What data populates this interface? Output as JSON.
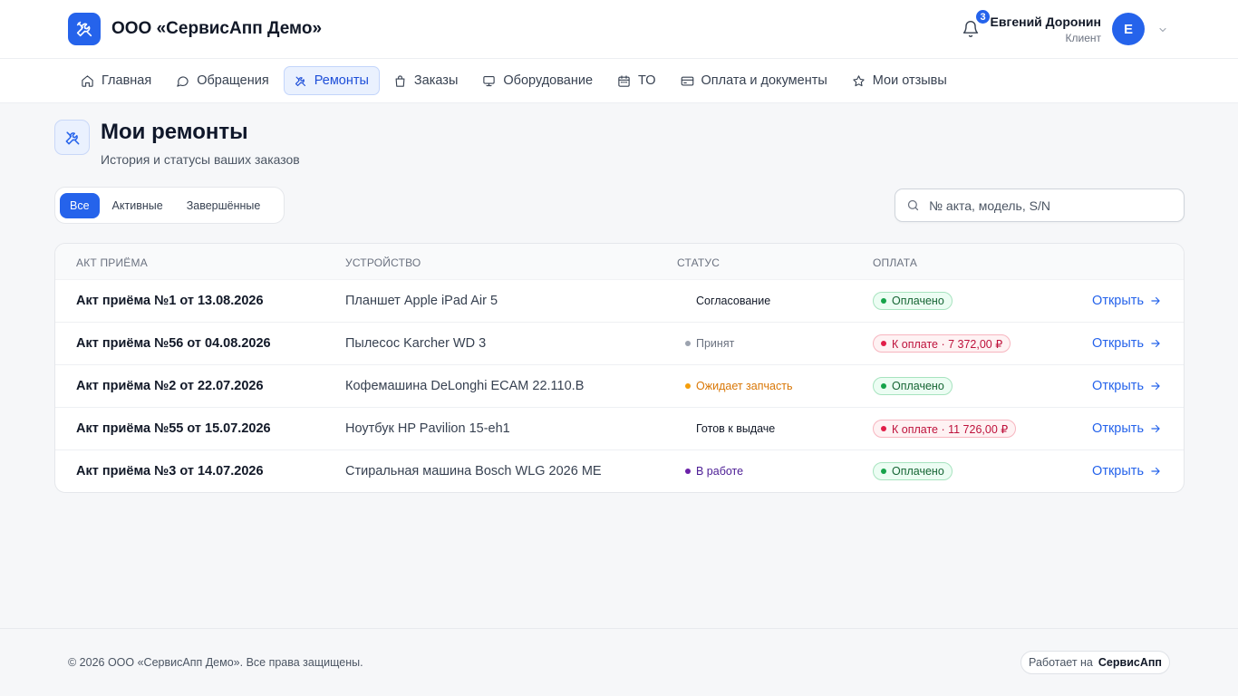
{
  "header": {
    "brand_name": "ООО «СервисАпп Демо»",
    "notifications_count": "3",
    "user_name": "Евгений Доронин",
    "user_role": "Клиент",
    "avatar_letter": "Е"
  },
  "nav": {
    "items": [
      {
        "label": "Главная",
        "icon": "home-icon"
      },
      {
        "label": "Обращения",
        "icon": "chat-icon"
      },
      {
        "label": "Ремонты",
        "icon": "tools-icon",
        "active": true
      },
      {
        "label": "Заказы",
        "icon": "bag-icon"
      },
      {
        "label": "Оборудование",
        "icon": "monitor-icon"
      },
      {
        "label": "ТО",
        "icon": "calendar-icon"
      },
      {
        "label": "Оплата и документы",
        "icon": "card-icon"
      },
      {
        "label": "Мои отзывы",
        "icon": "star-icon"
      }
    ]
  },
  "page": {
    "title": "Мои ремонты",
    "subtitle": "История и статусы ваших заказов"
  },
  "filters": {
    "all": "Все",
    "active": "Активные",
    "completed": "Завершённые"
  },
  "search": {
    "placeholder": "№ акта, модель, S/N"
  },
  "table": {
    "headers": {
      "act": "АКТ ПРИЁМА",
      "device": "УСТРОЙСТВО",
      "status": "СТАТУС",
      "payment": "ОПЛАТА"
    },
    "open_label": "Открыть",
    "rows": [
      {
        "act": "Акт приёма №1 от 13.08.2026",
        "device": "Планшет Apple iPad Air 5",
        "status": "Согласование",
        "status_color": "#111827",
        "status_dot": "",
        "payment": "Оплачено",
        "payment_type": "paid"
      },
      {
        "act": "Акт приёма №56 от 04.08.2026",
        "device": "Пылесос Karcher WD 3",
        "status": "Принят",
        "status_color": "#6b7280",
        "status_dot": "#9ca3af",
        "payment": "К оплате · 7 372,00 ₽",
        "payment_type": "due"
      },
      {
        "act": "Акт приёма №2 от 22.07.2026",
        "device": "Кофемашина DeLonghi ECAM 22.110.B",
        "status": "Ожидает запчасть",
        "status_color": "#d97706",
        "status_dot": "#f59e0b",
        "payment": "Оплачено",
        "payment_type": "paid"
      },
      {
        "act": "Акт приёма №55 от 15.07.2026",
        "device": "Ноутбук HP Pavilion 15-eh1",
        "status": "Готов к выдаче",
        "status_color": "#111827",
        "status_dot": "",
        "payment": "К оплате · 11 726,00 ₽",
        "payment_type": "due"
      },
      {
        "act": "Акт приёма №3 от 14.07.2026",
        "device": "Стиральная машина Bosch WLG 2026 ME",
        "status": "В работе",
        "status_color": "#4c1d95",
        "status_dot": "#6b21a8",
        "payment": "Оплачено",
        "payment_type": "paid"
      }
    ]
  },
  "footer": {
    "copyright": "© 2026 ООО «СервисАпп Демо». Все права защищены.",
    "powered_prefix": "Работает на",
    "powered_brand": "СервисАпп"
  },
  "colors": {
    "accent": "#2563eb",
    "paid": "#16a34a",
    "due": "#e11d48"
  }
}
